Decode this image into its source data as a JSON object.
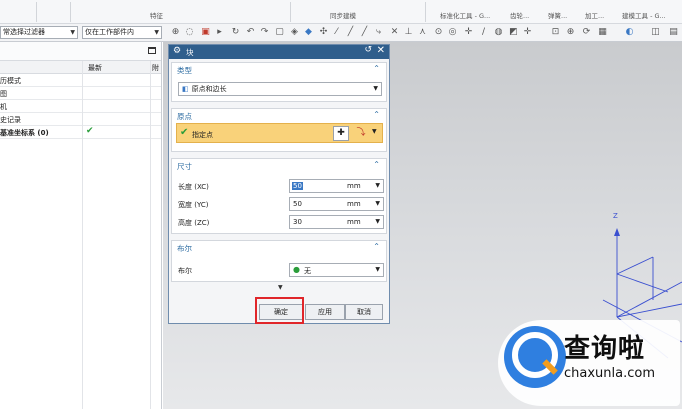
{
  "ribbon": {
    "groups": [
      "特征",
      "同步建模",
      "标准化工具 - G...",
      "齿轮...",
      "弹簧...",
      "加工...",
      "建模工具 - G..."
    ]
  },
  "toolbar": {
    "filter_select": "常选择过滤器",
    "scope_select": "仅在工作部件内"
  },
  "navigator": {
    "columns": [
      "",
      "最新",
      "附"
    ],
    "rows": [
      {
        "name": "历模式",
        "latest": ""
      },
      {
        "name": "图",
        "latest": ""
      },
      {
        "name": "机",
        "latest": ""
      },
      {
        "name": "史记录",
        "latest": ""
      },
      {
        "name": "基准坐标系 (0)",
        "latest": "✔"
      }
    ]
  },
  "dialog": {
    "title": "块",
    "type_section": {
      "label": "类型",
      "value": "原点和边长"
    },
    "origin_section": {
      "label": "原点",
      "point_label": "指定点"
    },
    "size_section": {
      "label": "尺寸",
      "fields": [
        {
          "label": "长度 (XC)",
          "value": "50",
          "unit": "mm"
        },
        {
          "label": "宽度 (YC)",
          "value": "50",
          "unit": "mm"
        },
        {
          "label": "高度 (ZC)",
          "value": "30",
          "unit": "mm"
        }
      ]
    },
    "bool_section": {
      "label": "布尔",
      "field_label": "布尔",
      "value": "无"
    },
    "buttons": {
      "ok": "确定",
      "apply": "应用",
      "cancel": "取消"
    }
  },
  "viewport": {
    "axis_label": "Z"
  },
  "watermark": {
    "brand": "查询啦",
    "url": "chaxunla.com"
  }
}
